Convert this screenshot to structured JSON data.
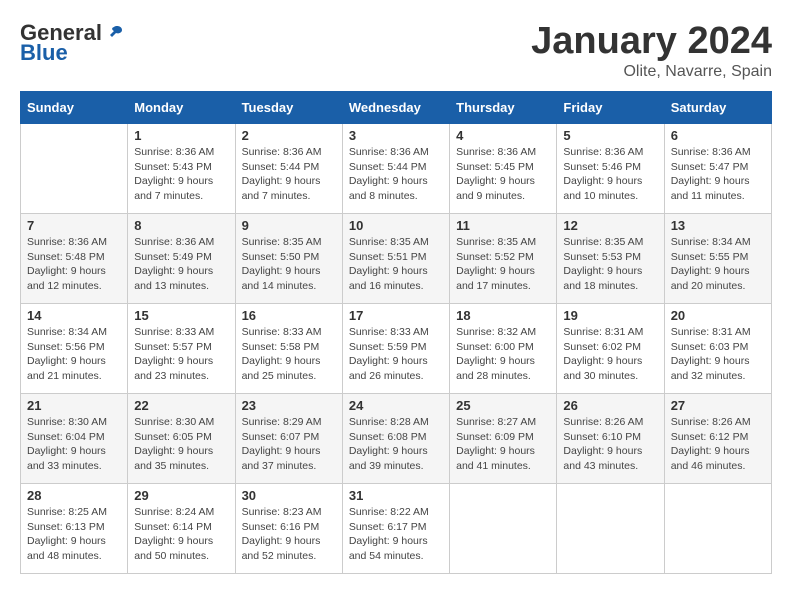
{
  "logo": {
    "general": "General",
    "blue": "Blue"
  },
  "title": "January 2024",
  "subtitle": "Olite, Navarre, Spain",
  "days_header": [
    "Sunday",
    "Monday",
    "Tuesday",
    "Wednesday",
    "Thursday",
    "Friday",
    "Saturday"
  ],
  "weeks": [
    [
      {
        "day": "",
        "info": ""
      },
      {
        "day": "1",
        "info": "Sunrise: 8:36 AM\nSunset: 5:43 PM\nDaylight: 9 hours\nand 7 minutes."
      },
      {
        "day": "2",
        "info": "Sunrise: 8:36 AM\nSunset: 5:44 PM\nDaylight: 9 hours\nand 7 minutes."
      },
      {
        "day": "3",
        "info": "Sunrise: 8:36 AM\nSunset: 5:44 PM\nDaylight: 9 hours\nand 8 minutes."
      },
      {
        "day": "4",
        "info": "Sunrise: 8:36 AM\nSunset: 5:45 PM\nDaylight: 9 hours\nand 9 minutes."
      },
      {
        "day": "5",
        "info": "Sunrise: 8:36 AM\nSunset: 5:46 PM\nDaylight: 9 hours\nand 10 minutes."
      },
      {
        "day": "6",
        "info": "Sunrise: 8:36 AM\nSunset: 5:47 PM\nDaylight: 9 hours\nand 11 minutes."
      }
    ],
    [
      {
        "day": "7",
        "info": "Sunrise: 8:36 AM\nSunset: 5:48 PM\nDaylight: 9 hours\nand 12 minutes."
      },
      {
        "day": "8",
        "info": "Sunrise: 8:36 AM\nSunset: 5:49 PM\nDaylight: 9 hours\nand 13 minutes."
      },
      {
        "day": "9",
        "info": "Sunrise: 8:35 AM\nSunset: 5:50 PM\nDaylight: 9 hours\nand 14 minutes."
      },
      {
        "day": "10",
        "info": "Sunrise: 8:35 AM\nSunset: 5:51 PM\nDaylight: 9 hours\nand 16 minutes."
      },
      {
        "day": "11",
        "info": "Sunrise: 8:35 AM\nSunset: 5:52 PM\nDaylight: 9 hours\nand 17 minutes."
      },
      {
        "day": "12",
        "info": "Sunrise: 8:35 AM\nSunset: 5:53 PM\nDaylight: 9 hours\nand 18 minutes."
      },
      {
        "day": "13",
        "info": "Sunrise: 8:34 AM\nSunset: 5:55 PM\nDaylight: 9 hours\nand 20 minutes."
      }
    ],
    [
      {
        "day": "14",
        "info": "Sunrise: 8:34 AM\nSunset: 5:56 PM\nDaylight: 9 hours\nand 21 minutes."
      },
      {
        "day": "15",
        "info": "Sunrise: 8:33 AM\nSunset: 5:57 PM\nDaylight: 9 hours\nand 23 minutes."
      },
      {
        "day": "16",
        "info": "Sunrise: 8:33 AM\nSunset: 5:58 PM\nDaylight: 9 hours\nand 25 minutes."
      },
      {
        "day": "17",
        "info": "Sunrise: 8:33 AM\nSunset: 5:59 PM\nDaylight: 9 hours\nand 26 minutes."
      },
      {
        "day": "18",
        "info": "Sunrise: 8:32 AM\nSunset: 6:00 PM\nDaylight: 9 hours\nand 28 minutes."
      },
      {
        "day": "19",
        "info": "Sunrise: 8:31 AM\nSunset: 6:02 PM\nDaylight: 9 hours\nand 30 minutes."
      },
      {
        "day": "20",
        "info": "Sunrise: 8:31 AM\nSunset: 6:03 PM\nDaylight: 9 hours\nand 32 minutes."
      }
    ],
    [
      {
        "day": "21",
        "info": "Sunrise: 8:30 AM\nSunset: 6:04 PM\nDaylight: 9 hours\nand 33 minutes."
      },
      {
        "day": "22",
        "info": "Sunrise: 8:30 AM\nSunset: 6:05 PM\nDaylight: 9 hours\nand 35 minutes."
      },
      {
        "day": "23",
        "info": "Sunrise: 8:29 AM\nSunset: 6:07 PM\nDaylight: 9 hours\nand 37 minutes."
      },
      {
        "day": "24",
        "info": "Sunrise: 8:28 AM\nSunset: 6:08 PM\nDaylight: 9 hours\nand 39 minutes."
      },
      {
        "day": "25",
        "info": "Sunrise: 8:27 AM\nSunset: 6:09 PM\nDaylight: 9 hours\nand 41 minutes."
      },
      {
        "day": "26",
        "info": "Sunrise: 8:26 AM\nSunset: 6:10 PM\nDaylight: 9 hours\nand 43 minutes."
      },
      {
        "day": "27",
        "info": "Sunrise: 8:26 AM\nSunset: 6:12 PM\nDaylight: 9 hours\nand 46 minutes."
      }
    ],
    [
      {
        "day": "28",
        "info": "Sunrise: 8:25 AM\nSunset: 6:13 PM\nDaylight: 9 hours\nand 48 minutes."
      },
      {
        "day": "29",
        "info": "Sunrise: 8:24 AM\nSunset: 6:14 PM\nDaylight: 9 hours\nand 50 minutes."
      },
      {
        "day": "30",
        "info": "Sunrise: 8:23 AM\nSunset: 6:16 PM\nDaylight: 9 hours\nand 52 minutes."
      },
      {
        "day": "31",
        "info": "Sunrise: 8:22 AM\nSunset: 6:17 PM\nDaylight: 9 hours\nand 54 minutes."
      },
      {
        "day": "",
        "info": ""
      },
      {
        "day": "",
        "info": ""
      },
      {
        "day": "",
        "info": ""
      }
    ]
  ]
}
